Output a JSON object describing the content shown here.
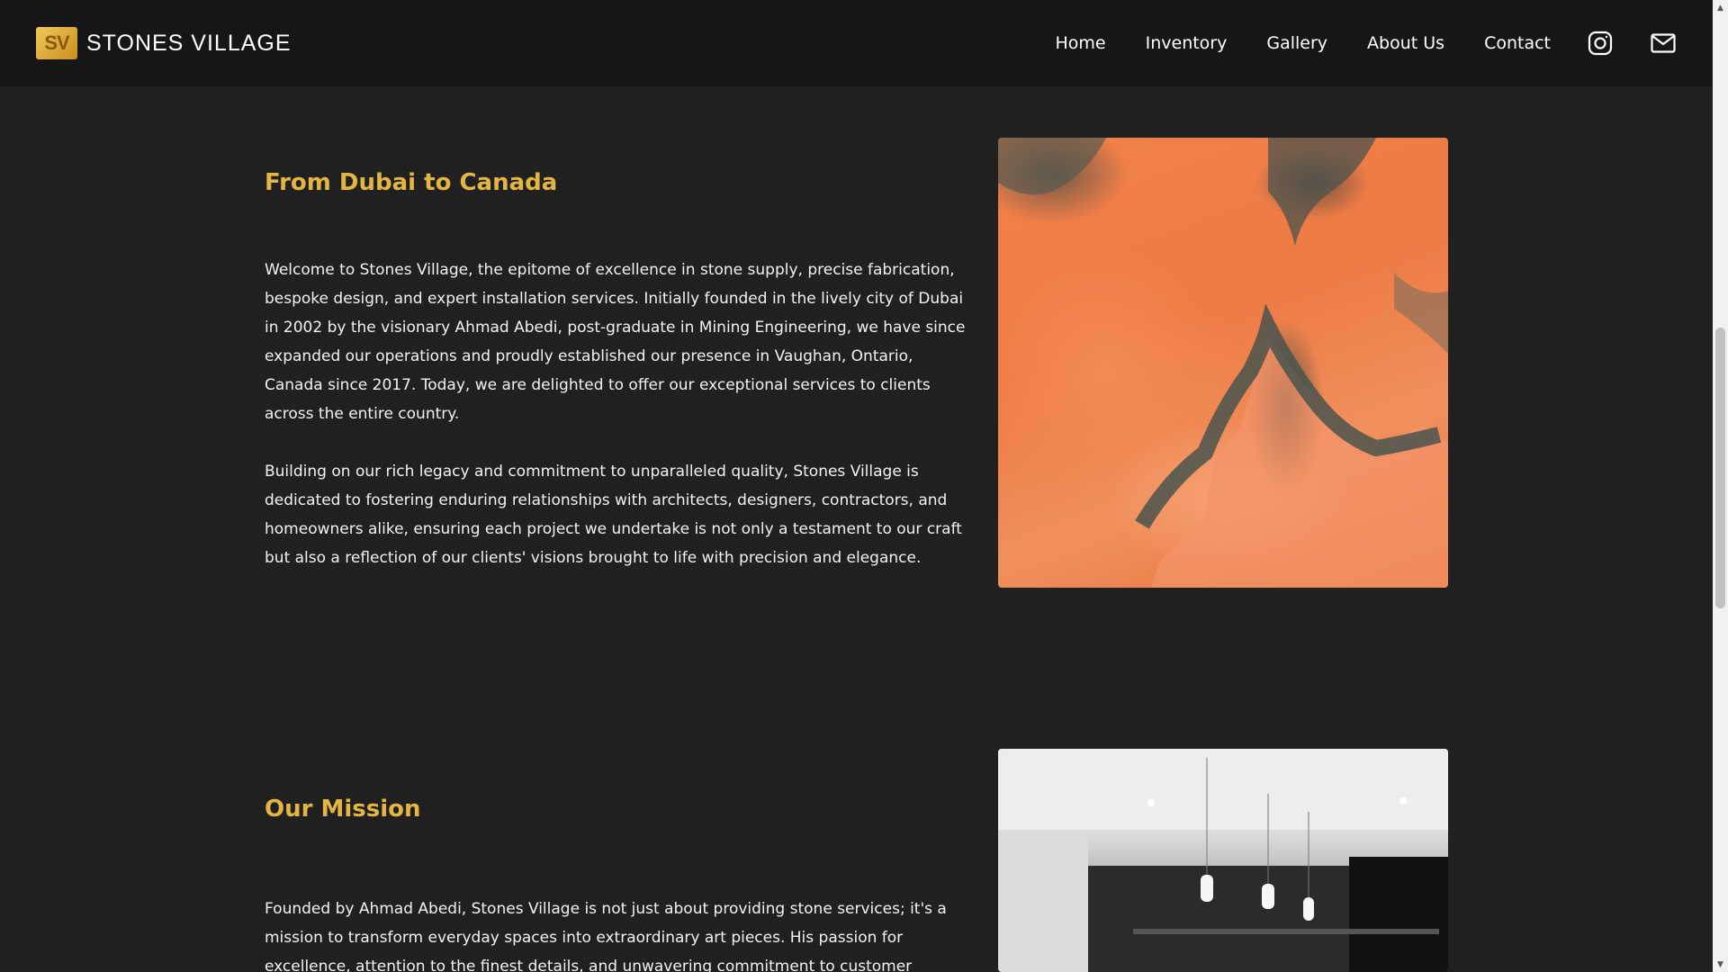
{
  "header": {
    "logo_text": "SV",
    "brand_name": "STONES VILLAGE",
    "nav": [
      {
        "label": "Home"
      },
      {
        "label": "Inventory"
      },
      {
        "label": "Gallery"
      },
      {
        "label": "About Us"
      },
      {
        "label": "Contact"
      }
    ],
    "icons": [
      "instagram-icon",
      "mail-icon"
    ]
  },
  "sections": [
    {
      "title": "From Dubai to Canada",
      "paragraphs": [
        "Welcome to Stones Village, the epitome of excellence in stone supply, precise fabrication, bespoke design, and expert installation services. Initially founded in the lively city of Dubai in 2002 by the visionary Ahmad Abedi, post-graduate in Mining Engineering, we have since expanded our operations and proudly established our presence in Vaughan, Ontario, Canada since 2017. Today, we are delighted to offer our exceptional services to clients across the entire country.",
        "Building on our rich legacy and commitment to unparalleled quality, Stones Village is dedicated to fostering enduring relationships with architects, designers, contractors, and homeowners alike, ensuring each project we undertake is not only a testament to our craft but also a reflection of our clients' visions brought to life with precision and elegance."
      ]
    },
    {
      "title": "Our Mission",
      "paragraphs": [
        "Founded by Ahmad Abedi, Stones Village is not just about providing stone services; it's a mission to transform everyday spaces into extraordinary art pieces. His passion for excellence, attention to the finest details, and unwavering commitment to customer satisfaction have been the"
      ]
    }
  ],
  "colors": {
    "background": "#202020",
    "navbar": "#161616",
    "accent": "#e3b643",
    "text": "#f2f2f2"
  }
}
